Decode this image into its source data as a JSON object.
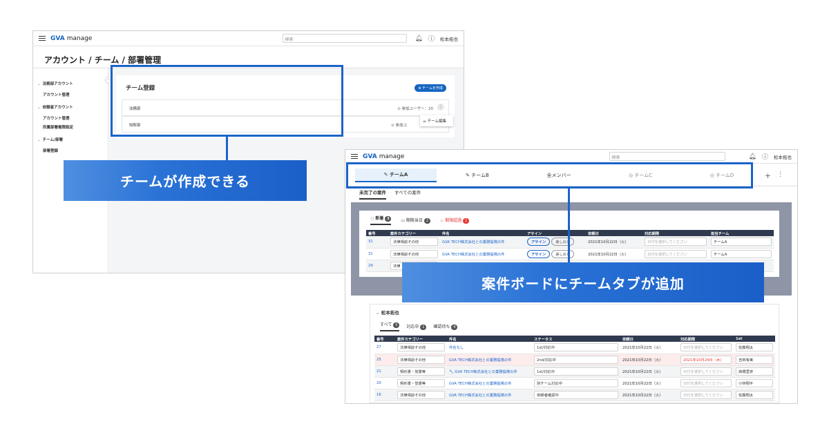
{
  "colors": {
    "accent": "#1a63c9",
    "brand": "#1565c0",
    "header_dark": "#2f3a4f",
    "danger": "#e53935"
  },
  "app": {
    "logo_text": "GVA",
    "logo_suffix": "manage",
    "search_placeholder": "検索",
    "user_name": "松本拓也"
  },
  "screen1": {
    "page_title": "アカウント / チーム / 部署管理",
    "sidebar": [
      {
        "header": "法務部アカウント",
        "items": [
          "アカウント管理"
        ]
      },
      {
        "header": "依頼者アカウント",
        "items": [
          "アカウント管理",
          "所属部署権限設定"
        ]
      },
      {
        "header": "チーム/部署",
        "items": [
          "部署登録"
        ]
      }
    ],
    "card_title": "チーム登録",
    "create_button": "⊕ チームを作成",
    "teams": [
      {
        "name": "法務部",
        "count": "⊙ 参加ユーザー：20"
      },
      {
        "name": "知財部",
        "count": "⊙ 参加ユ"
      }
    ],
    "edit_menu": "⚌ チーム編集"
  },
  "banner1": "チームが作成できる",
  "banner2": "案件ボードにチームタブが追加",
  "screen2": {
    "team_tabs": [
      {
        "label": "チームA",
        "icon": "✎",
        "state": "active"
      },
      {
        "label": "チームB",
        "icon": "✎",
        "state": "normal"
      },
      {
        "label": "全メンバー",
        "icon": "",
        "state": "normal"
      },
      {
        "label": "チームC",
        "icon": "◎",
        "state": "dim"
      },
      {
        "label": "チームD",
        "icon": "◎",
        "state": "dim"
      }
    ],
    "plus": "+",
    "more": "⋮",
    "subtabs": [
      "未完了の案件",
      "すべての案件"
    ],
    "pills": [
      {
        "label": "新着",
        "count": "3"
      },
      {
        "label": "期限当日",
        "count": "2"
      },
      {
        "label": "期限超過",
        "count": "1"
      }
    ],
    "upper_table": {
      "headers": [
        "番号",
        "案件カテゴリー",
        "件名",
        "アサイン",
        "依頼日",
        "対応期限",
        "担当チーム"
      ],
      "rows": [
        {
          "no": "31",
          "cat": "法律相談その他",
          "title": "GVA TECH株式会社との業務提携の件",
          "assign": "アサイン",
          "none": "差し戻し",
          "date": "2021年10月22日（火）",
          "due": "日付を選択してください",
          "team": "チームA"
        },
        {
          "no": "31",
          "cat": "法律相談その他",
          "title": "GVA TECH株式会社との業務提携の件",
          "assign": "アサイン",
          "none": "差し戻し",
          "date": "2021年10月22日（火）",
          "due": "日付を選択してください",
          "team": "チームA"
        },
        {
          "no": "29",
          "cat": "法律",
          "title": "",
          "assign": "",
          "none": "",
          "date": "",
          "due": "",
          "team": ""
        }
      ]
    },
    "lower": {
      "header": "松本拓也",
      "tabs": [
        {
          "label": "すべて",
          "count": "5"
        },
        {
          "label": "対応中",
          "count": "1"
        },
        {
          "label": "確認待ち",
          "count": "4"
        }
      ],
      "headers": [
        "番号",
        "案件カテゴリー",
        "件名",
        "ステータス",
        "依頼日",
        "対応期限",
        "1st"
      ],
      "rows": [
        {
          "no": "27",
          "cat": "法律相談その他",
          "title": "件名なし",
          "status": "1st/対応中",
          "date": "2021年10月22日（火）",
          "due": "日付を選択してください",
          "first": "佐藤翔太"
        },
        {
          "no": "25",
          "cat": "法律相談その他",
          "title": "GVA TECH株式会社との業務提携の件",
          "status": "2nd/対応中",
          "date": "2021年10月22日（火）",
          "due": "2021年10月24日（木）",
          "first": "吉田有美"
        },
        {
          "no": "21",
          "cat": "契約書・覚書等",
          "title": "🔧 GVA TECH株式会社との業務提携の件",
          "status": "1st/対応中",
          "date": "2021年10月22日（火）",
          "due": "日付を選択してください",
          "first": "高橋里奈"
        },
        {
          "no": "20",
          "cat": "契約書・覚書等",
          "title": "GVA TECH株式会社との業務提携の件",
          "status": "別チーム対応中",
          "date": "2021年10月22日（火）",
          "due": "日付を選択してください",
          "first": "小林翔平"
        },
        {
          "no": "16",
          "cat": "法律相談その他",
          "title": "GVA TECH株式会社との業務提携の件",
          "status": "依頼者確認中",
          "date": "2021年10月22日（火）",
          "due": "日付を選択してください",
          "first": "佐藤翔太"
        }
      ]
    }
  }
}
